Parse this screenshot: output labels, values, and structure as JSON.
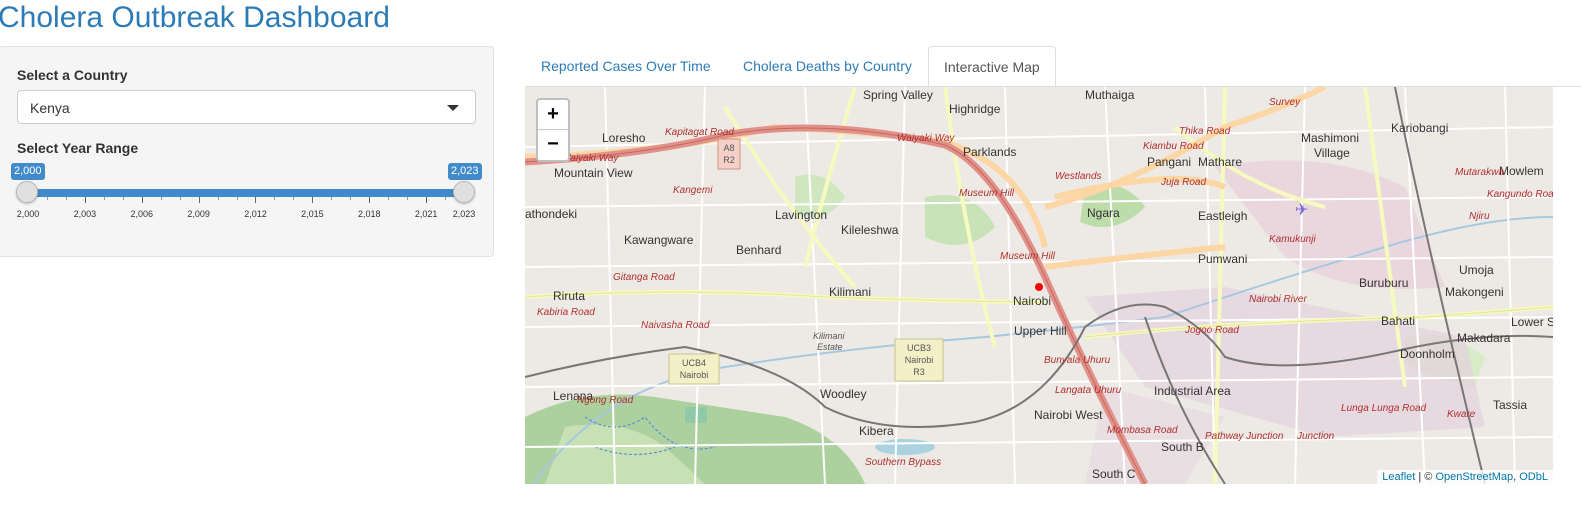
{
  "app": {
    "title": "Cholera Outbreak Dashboard"
  },
  "sidebar": {
    "country_label": "Select a Country",
    "country_value": "Kenya",
    "year_label": "Select Year Range",
    "year_range": {
      "min": 2000,
      "max": 2023,
      "from": 2000,
      "to": 2023,
      "from_label": "2,000",
      "to_label": "2,023"
    },
    "tick_labels": [
      "2,000",
      "2,003",
      "2,006",
      "2,009",
      "2,012",
      "2,015",
      "2,018",
      "2,021",
      "2,023"
    ]
  },
  "tabs": [
    {
      "label": "Reported Cases Over Time",
      "active": false
    },
    {
      "label": "Cholera Deaths by Country",
      "active": false
    },
    {
      "label": "Interactive Map",
      "active": true
    }
  ],
  "map": {
    "zoom_in": "+",
    "zoom_out": "−",
    "marker_color": "#ff0000",
    "attribution": {
      "leaflet": "Leaflet",
      "separator": " | © ",
      "osm": "OpenStreetMap",
      "odbl": "ODbL"
    },
    "place_labels": [
      "Spring Valley",
      "Highridge",
      "Muthaiga",
      "Loresho",
      "Mountain View",
      "Parklands",
      "Pangani",
      "Mathare",
      "Mashimoni",
      "Village",
      "Kariobangi",
      "Mowlem",
      "Lavington",
      "Kileleshwa",
      "Ngara",
      "Eastleigh",
      "Kawangware",
      "Benhard",
      "Kilimani",
      "Nairobi",
      "Pumwani",
      "Buruburu",
      "Umoja",
      "Riruta",
      "Upper Hill",
      "Bahati",
      "Makadara",
      "Lower Savan",
      "Makongeni",
      "Doonholm",
      "Industrial Area",
      "Lenana",
      "Woodley",
      "Kibera",
      "Nairobi West",
      "South B",
      "South C",
      "Tassia",
      "athondeki",
      "Kamukunji"
    ],
    "road_labels": [
      "Waiyaki Way",
      "Waiyaki Way",
      "Museum Hill",
      "Museum Hill",
      "Kiambu Road",
      "Thika Road",
      "Juja Road",
      "Mutarakwa",
      "Kangundo Road",
      "Njiru",
      "Gitanga Road",
      "Kabiria Road",
      "Naivasha Road",
      "Ngong Road",
      "Bunyala Uhuru",
      "Langata Uhuru",
      "Pathway Junction",
      "Junction",
      "Lunga Lunga Road",
      "Kware",
      "Mombasa Road",
      "Southern Bypass",
      "Jogoo Road",
      "Survey",
      "Westlands",
      "Nairobi River",
      "Kangemi",
      "Kapitagat Road"
    ],
    "shields": [
      {
        "lines": [
          "A8",
          "R2"
        ]
      },
      {
        "lines": [
          "UCB4",
          "Nairobi"
        ]
      },
      {
        "lines": [
          "UCB3",
          "Nairobi",
          "R3"
        ]
      }
    ],
    "small_labels": [
      "Kilimani",
      "Estate"
    ]
  },
  "colors": {
    "accent": "#2c7bb6",
    "slider": "#428bca"
  }
}
